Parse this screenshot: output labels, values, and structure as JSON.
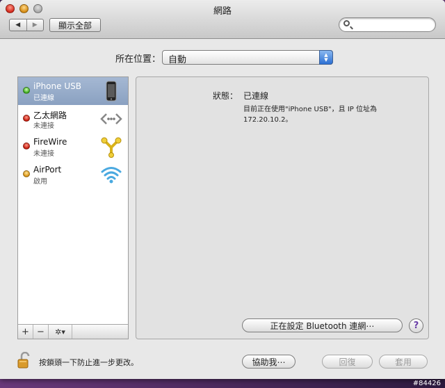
{
  "window": {
    "title": "網路"
  },
  "toolbar": {
    "back_label": "◀",
    "forward_label": "▶",
    "show_all_label": "顯示全部",
    "search_placeholder": ""
  },
  "location": {
    "label": "所在位置：",
    "value": "自動"
  },
  "services": [
    {
      "name": "iPhone USB",
      "status": "已連線",
      "indicator": "green",
      "icon": "iphone-icon",
      "selected": true
    },
    {
      "name": "乙太網路",
      "status": "未連接",
      "indicator": "red",
      "icon": "ethernet-icon",
      "selected": false
    },
    {
      "name": "FireWire",
      "status": "未連接",
      "indicator": "red",
      "icon": "firewire-icon",
      "selected": false
    },
    {
      "name": "AirPort",
      "status": "啟用",
      "indicator": "yellow",
      "icon": "wifi-icon",
      "selected": false
    }
  ],
  "sidebar_controls": {
    "add": "+",
    "remove": "−",
    "gear": "✲▾"
  },
  "detail": {
    "status_label": "狀態：",
    "status_value": "已連線",
    "description": "目前正在使用\"iPhone USB\"，且 IP 位址為 172.20.10.2。",
    "bluetooth_button": "正在設定 Bluetooth 連網⋯",
    "help_label": "?"
  },
  "footer": {
    "lock_text": "按鎖頭一下防止進一步更改。",
    "assist_button": "協助我⋯",
    "revert_button": "回復",
    "apply_button": "套用"
  },
  "watermark": "#84426",
  "colors": {
    "selection": "#8aa1c1",
    "accent": "#2c6fd3"
  }
}
